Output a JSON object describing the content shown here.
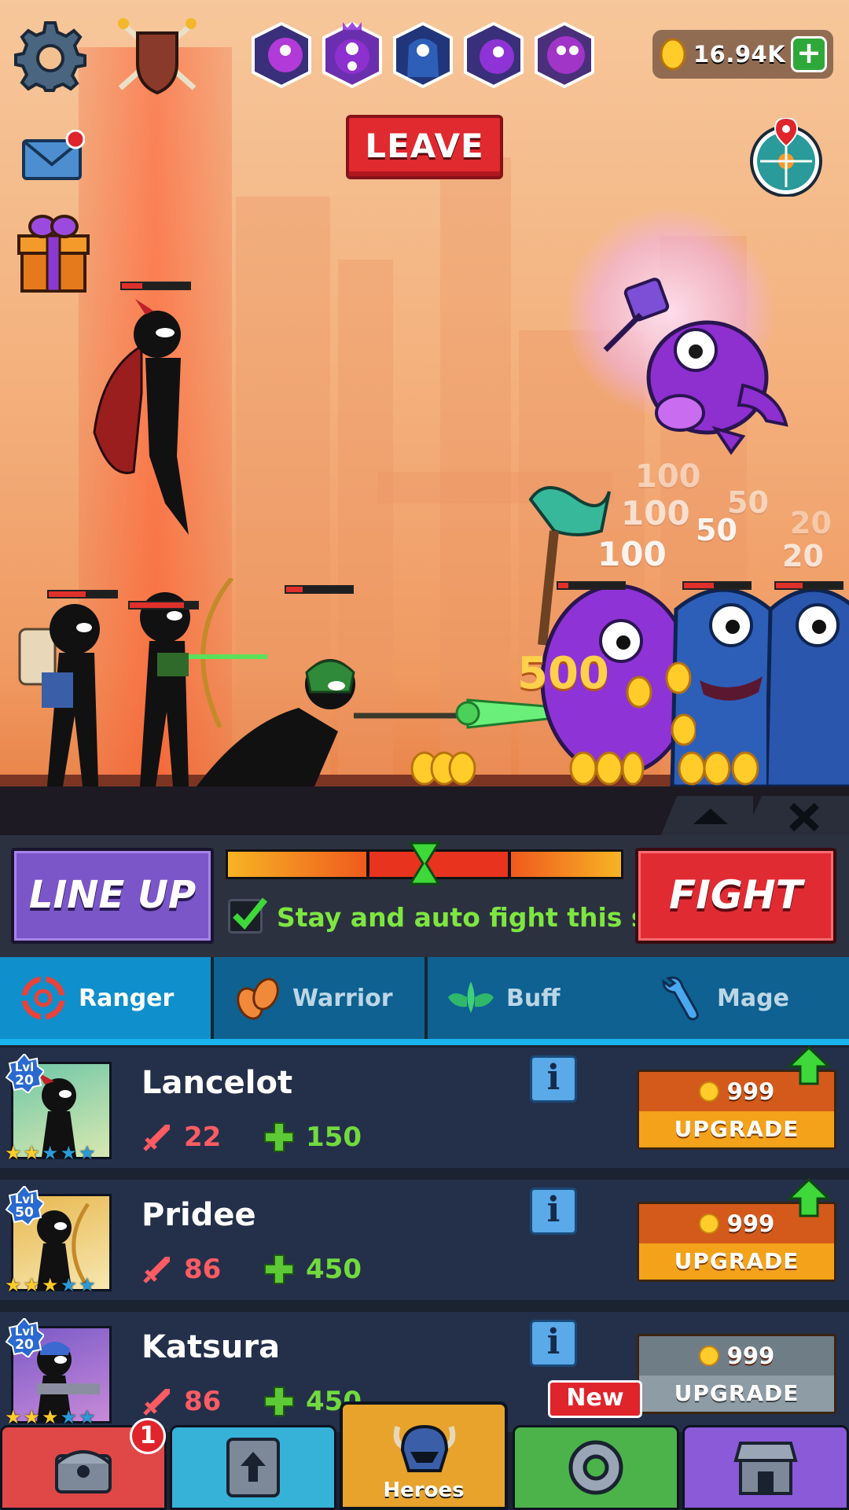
{
  "currency": {
    "coins": "16.94K"
  },
  "top_bar": {
    "leave_label": "LEAVE"
  },
  "damage_numbers": [
    "100",
    "100",
    "100",
    "50",
    "50",
    "20",
    "20",
    "500"
  ],
  "controls": {
    "lineup_label": "LINE UP",
    "fight_label": "FIGHT",
    "auto_fight_label": "Stay and auto fight this stage",
    "auto_fight_checked": true
  },
  "class_tabs": [
    {
      "label": "Ranger",
      "icon": "target-icon",
      "active": true
    },
    {
      "label": "Warrior",
      "icon": "fists-icon",
      "active": false
    },
    {
      "label": "Buff",
      "icon": "wings-icon",
      "active": false
    },
    {
      "label": "Mage",
      "icon": "wrench-icon",
      "active": false
    }
  ],
  "heroes": [
    {
      "name": "Lancelot",
      "level_prefix": "Lvl",
      "level": "20",
      "attack": "22",
      "health": "150",
      "stars_filled": 2,
      "stars_total": 5,
      "upgrade_cost": "999",
      "upgrade_label": "UPGRADE",
      "can_upgrade": true
    },
    {
      "name": "Pridee",
      "level_prefix": "Lvl",
      "level": "50",
      "attack": "86",
      "health": "450",
      "stars_filled": 3,
      "stars_total": 5,
      "upgrade_cost": "999",
      "upgrade_label": "UPGRADE",
      "can_upgrade": true
    },
    {
      "name": "Katsura",
      "level_prefix": "Lvl",
      "level": "20",
      "attack": "86",
      "health": "450",
      "stars_filled": 3,
      "stars_total": 5,
      "upgrade_cost": "999",
      "upgrade_label": "UPGRADE",
      "can_upgrade": false
    }
  ],
  "bottom_nav": {
    "heroes_label": "Heroes",
    "chest_badge": "1",
    "new_label": "New",
    "items": [
      "chest-icon",
      "book-upgrade-icon",
      "helmet-icon",
      "gear-wheel-icon",
      "shop-icon"
    ]
  },
  "colors": {
    "accent_red": "#e12930",
    "lineup_purple": "#7a56c8",
    "upgrade_orange": "#f3a21a",
    "tab_active": "#0f8fcb"
  }
}
